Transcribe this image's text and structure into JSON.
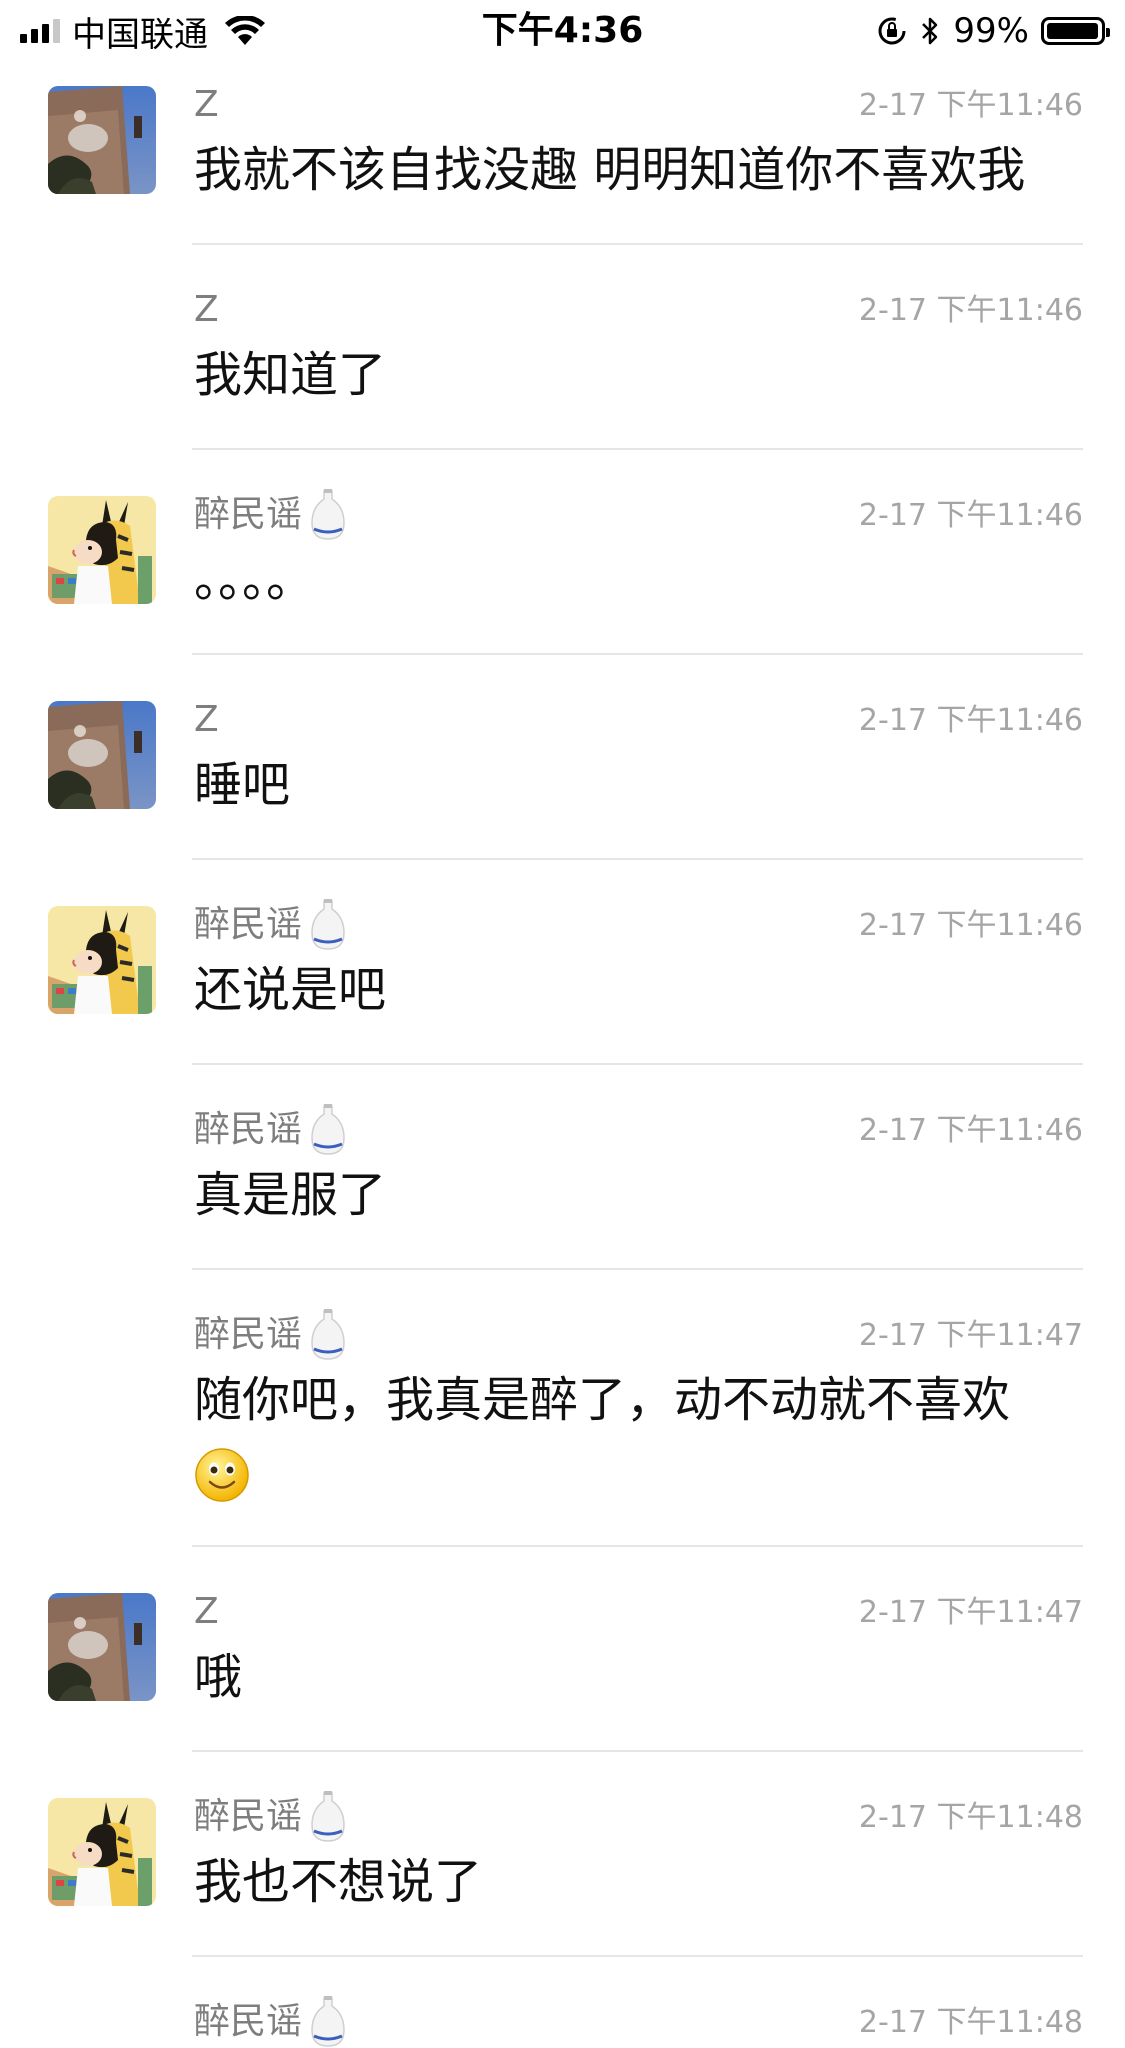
{
  "status_bar": {
    "carrier": "中国联通",
    "time": "下午4:36",
    "battery_percent": "99%",
    "battery_level": 0.99
  },
  "messages": [
    {
      "sender": "Z",
      "avatar": "z-avatar",
      "time": "2-17 下午11:46",
      "text": "我就不该自找没趣 明明知道你不喜欢我"
    },
    {
      "sender": "Z",
      "avatar": "",
      "time": "2-17 下午11:46",
      "text": "我知道了"
    },
    {
      "sender": "醉民谣",
      "avatar": "cartoon-avatar",
      "time": "2-17 下午11:46",
      "text": "。。。。"
    },
    {
      "sender": "Z",
      "avatar": "z-avatar",
      "time": "2-17 下午11:46",
      "text": "睡吧"
    },
    {
      "sender": "醉民谣",
      "avatar": "cartoon-avatar",
      "time": "2-17 下午11:46",
      "text": "还说是吧"
    },
    {
      "sender": "醉民谣",
      "avatar": "",
      "time": "2-17 下午11:46",
      "text": "真是服了"
    },
    {
      "sender": "醉民谣",
      "avatar": "",
      "time": "2-17 下午11:47",
      "text": "随你吧，我真是醉了，动不动就不喜欢",
      "emoji": "smiley-face"
    },
    {
      "sender": "Z",
      "avatar": "z-avatar",
      "time": "2-17 下午11:47",
      "text": "哦"
    },
    {
      "sender": "醉民谣",
      "avatar": "cartoon-avatar",
      "time": "2-17 下午11:48",
      "text": "我也不想说了"
    },
    {
      "sender": "醉民谣",
      "avatar": "",
      "time": "2-17 下午11:48",
      "text": ""
    }
  ],
  "icons": {
    "sake_bottle": "sake-bottle-icon",
    "wifi": "wifi-icon",
    "bluetooth": "bluetooth-icon",
    "rotation_lock": "rotation-lock-icon"
  }
}
